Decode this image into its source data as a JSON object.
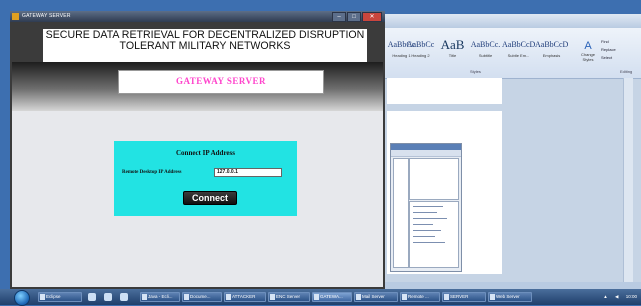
{
  "gateway_window": {
    "title": "GATEWAY SERVER",
    "controls": {
      "minimize": "–",
      "maximize": "□",
      "close": "✕"
    },
    "header_line1": "SECURE DATA RETRIEVAL FOR DECENTRALIZED DISRUPTION",
    "header_line2": "TOLERANT MILITARY NETWORKS",
    "server_label": "GATEWAY SERVER",
    "connect_form": {
      "title": "Connect IP Address",
      "ip_label": "Remote Desktop IP Address",
      "ip_value": "127.0.0.1",
      "connect_button": "Connect"
    }
  },
  "word_window": {
    "styles": [
      {
        "sample": "AaBbCc",
        "name": "Heading 1"
      },
      {
        "sample": "AaBbCc",
        "name": "Heading 2"
      },
      {
        "sample": "AaB",
        "name": "Title"
      },
      {
        "sample": "AaBbCc.",
        "name": "Subtitle"
      },
      {
        "sample": "AaBbCcDc",
        "name": "Subtle Em..."
      },
      {
        "sample": "AaBbCcDc",
        "name": "Emphasis"
      }
    ],
    "styles_group_label": "Styles",
    "change_styles": "Change Styles",
    "editing": [
      "Find",
      "Replace",
      "Select"
    ],
    "editing_group_label": "Editing"
  },
  "taskbar": {
    "tasks": [
      "Eclipse",
      "Java - Ecli...",
      "Docume...",
      "ATTACKER",
      "ENC Server",
      "GATEWA...",
      "Mail Server",
      "Remote ...",
      "SERVER",
      "Web Server"
    ],
    "clock": "10:00"
  },
  "colors": {
    "card": "#22e3e3",
    "server_label": "#ff44cc",
    "desktop": "#3d6fb0"
  }
}
